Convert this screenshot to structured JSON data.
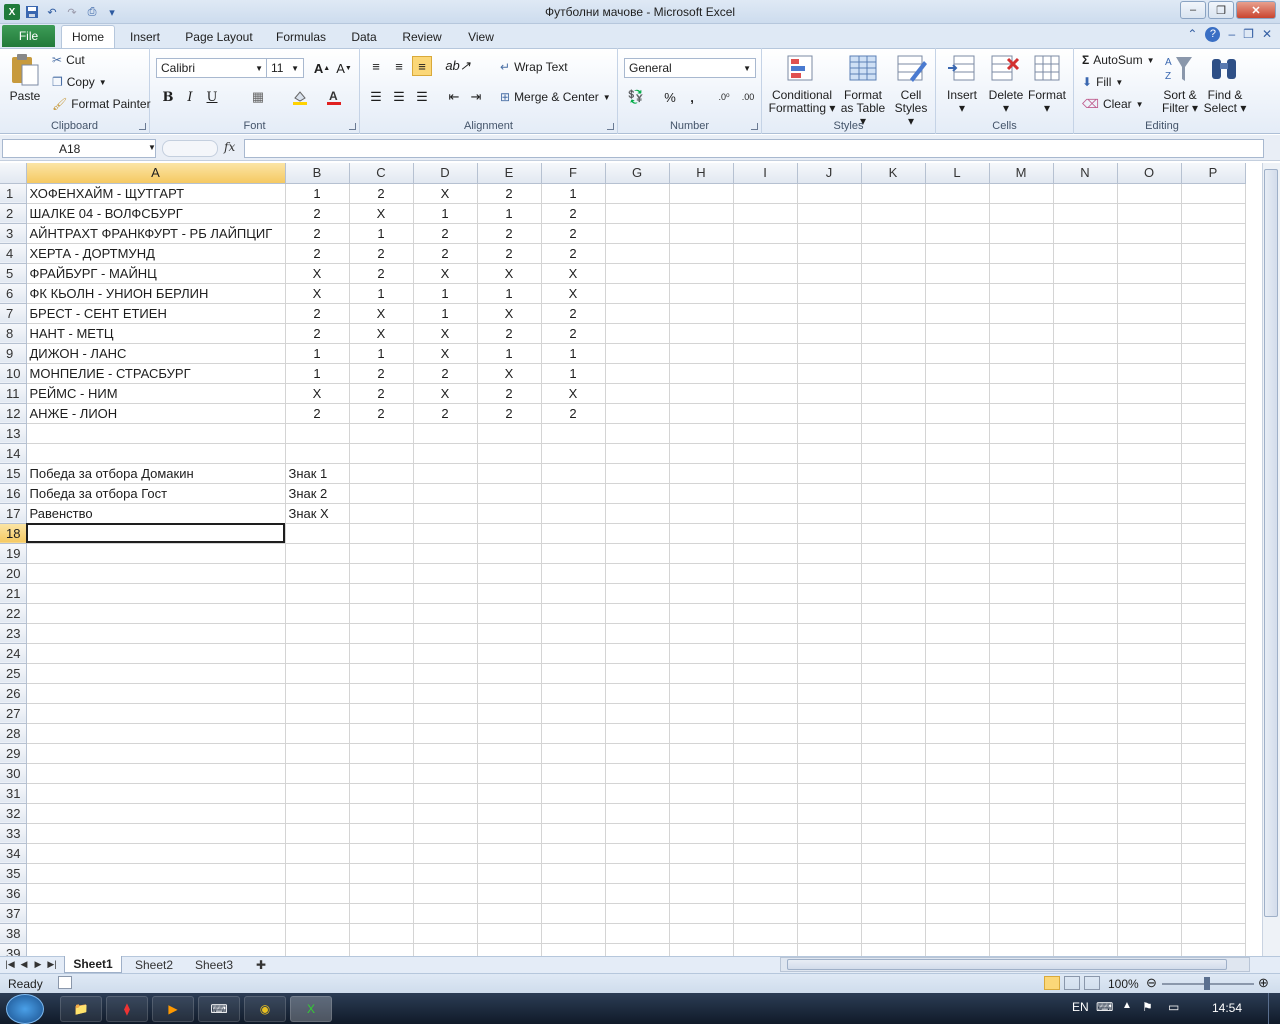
{
  "window": {
    "title": "Футболни мачове  -  Microsoft Excel"
  },
  "ribbon": {
    "tabs": [
      "File",
      "Home",
      "Insert",
      "Page Layout",
      "Formulas",
      "Data",
      "Review",
      "View"
    ],
    "clipboard": {
      "paste": "Paste",
      "cut": "Cut",
      "copy": "Copy",
      "format_painter": "Format Painter",
      "label": "Clipboard"
    },
    "font": {
      "name": "Calibri",
      "size": "11",
      "bold": "B",
      "italic": "I",
      "underline": "U",
      "label": "Font"
    },
    "alignment": {
      "wrap": "Wrap Text",
      "merge": "Merge & Center",
      "label": "Alignment"
    },
    "number": {
      "format": "General",
      "percent": "%",
      "comma": ",",
      "label": "Number"
    },
    "styles": {
      "conditional": "Conditional",
      "conditional2": "Formatting",
      "format_table": "Format",
      "format_table2": "as Table",
      "cell_styles": "Cell",
      "cell_styles2": "Styles",
      "label": "Styles"
    },
    "cells": {
      "insert": "Insert",
      "delete": "Delete",
      "format": "Format",
      "label": "Cells"
    },
    "editing": {
      "autosum": "AutoSum",
      "fill": "Fill",
      "clear": "Clear",
      "sort": "Sort &",
      "sort2": "Filter",
      "find": "Find &",
      "find2": "Select",
      "label": "Editing"
    }
  },
  "formula_bar": {
    "name_box": "A18",
    "fx": "fx",
    "value": ""
  },
  "sheet": {
    "columns": [
      "A",
      "B",
      "C",
      "D",
      "E",
      "F",
      "G",
      "H",
      "I",
      "J",
      "K",
      "L",
      "M",
      "N",
      "O",
      "P"
    ],
    "rows": [
      [
        "ХОФЕНХАЙМ - ЩУТГАРТ",
        "1",
        "2",
        "X",
        "2",
        "1"
      ],
      [
        "ШАЛКЕ  04 - ВОЛФСБУРГ",
        "2",
        "X",
        "1",
        "1",
        "2"
      ],
      [
        "АЙНТРАХТ  ФРАНКФУРТ - РБ  ЛАЙПЦИГ",
        "2",
        "1",
        "2",
        "2",
        "2"
      ],
      [
        "ХЕРТА - ДОРТМУНД",
        "2",
        "2",
        "2",
        "2",
        "2"
      ],
      [
        "ФРАЙБУРГ - МАЙНЦ",
        "X",
        "2",
        "X",
        "X",
        "X"
      ],
      [
        "ФК  КЬОЛН - УНИОН  БЕРЛИН",
        "X",
        "1",
        "1",
        "1",
        "X"
      ],
      [
        "БРЕСТ - СЕНТ  ЕТИЕН",
        "2",
        "X",
        "1",
        "X",
        "2"
      ],
      [
        "НАНТ - МЕТЦ",
        "2",
        "X",
        "X",
        "2",
        "2"
      ],
      [
        "ДИЖОН - ЛАНС",
        "1",
        "1",
        "X",
        "1",
        "1"
      ],
      [
        "МОНПЕЛИЕ - СТРАСБУРГ",
        "1",
        "2",
        "2",
        "X",
        "1"
      ],
      [
        "РЕЙМС - НИМ",
        "X",
        "2",
        "X",
        "2",
        "X"
      ],
      [
        "АНЖЕ - ЛИОН",
        "2",
        "2",
        "2",
        "2",
        "2"
      ],
      [
        "",
        "",
        "",
        "",
        "",
        ""
      ],
      [
        "",
        "",
        "",
        "",
        "",
        ""
      ],
      [
        "Победа за отбора Домакин",
        "Знак 1",
        "",
        "",
        "",
        ""
      ],
      [
        "Победа за отбора Гост",
        "Знак 2",
        "",
        "",
        "",
        ""
      ],
      [
        "Равенство",
        "Знак X",
        "",
        "",
        "",
        ""
      ]
    ],
    "visible_rows": 39,
    "active_cell_row": 18
  },
  "sheet_tabs": [
    "Sheet1",
    "Sheet2",
    "Sheet3"
  ],
  "status": {
    "ready": "Ready",
    "zoom": "100%"
  },
  "taskbar": {
    "lang": "EN",
    "time": "14:54"
  }
}
